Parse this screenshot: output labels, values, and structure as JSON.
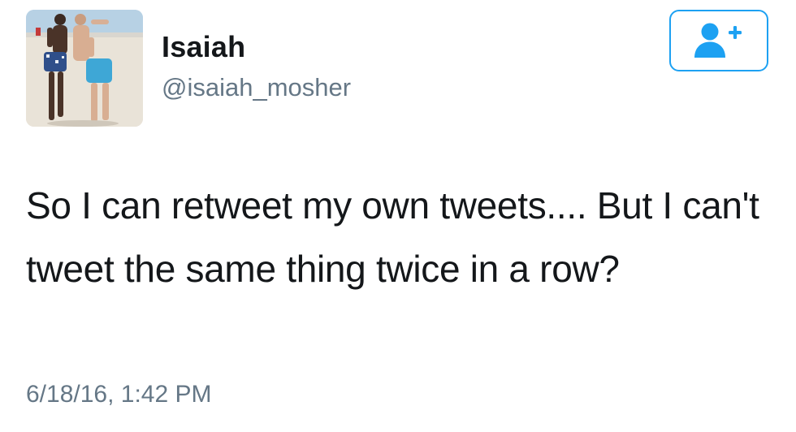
{
  "tweet": {
    "author": {
      "display_name": "Isaiah",
      "handle": "@isaiah_mosher",
      "avatar_icon": "profile-photo"
    },
    "follow_button": {
      "icon": "add-user-icon",
      "color": "#1da1f2"
    },
    "text": "So I can retweet my own tweets.... But I can't tweet the same thing twice in a row?",
    "timestamp": "6/18/16, 1:42 PM"
  },
  "colors": {
    "primary_text": "#14171a",
    "secondary_text": "#657786",
    "accent": "#1da1f2",
    "background": "#ffffff"
  }
}
